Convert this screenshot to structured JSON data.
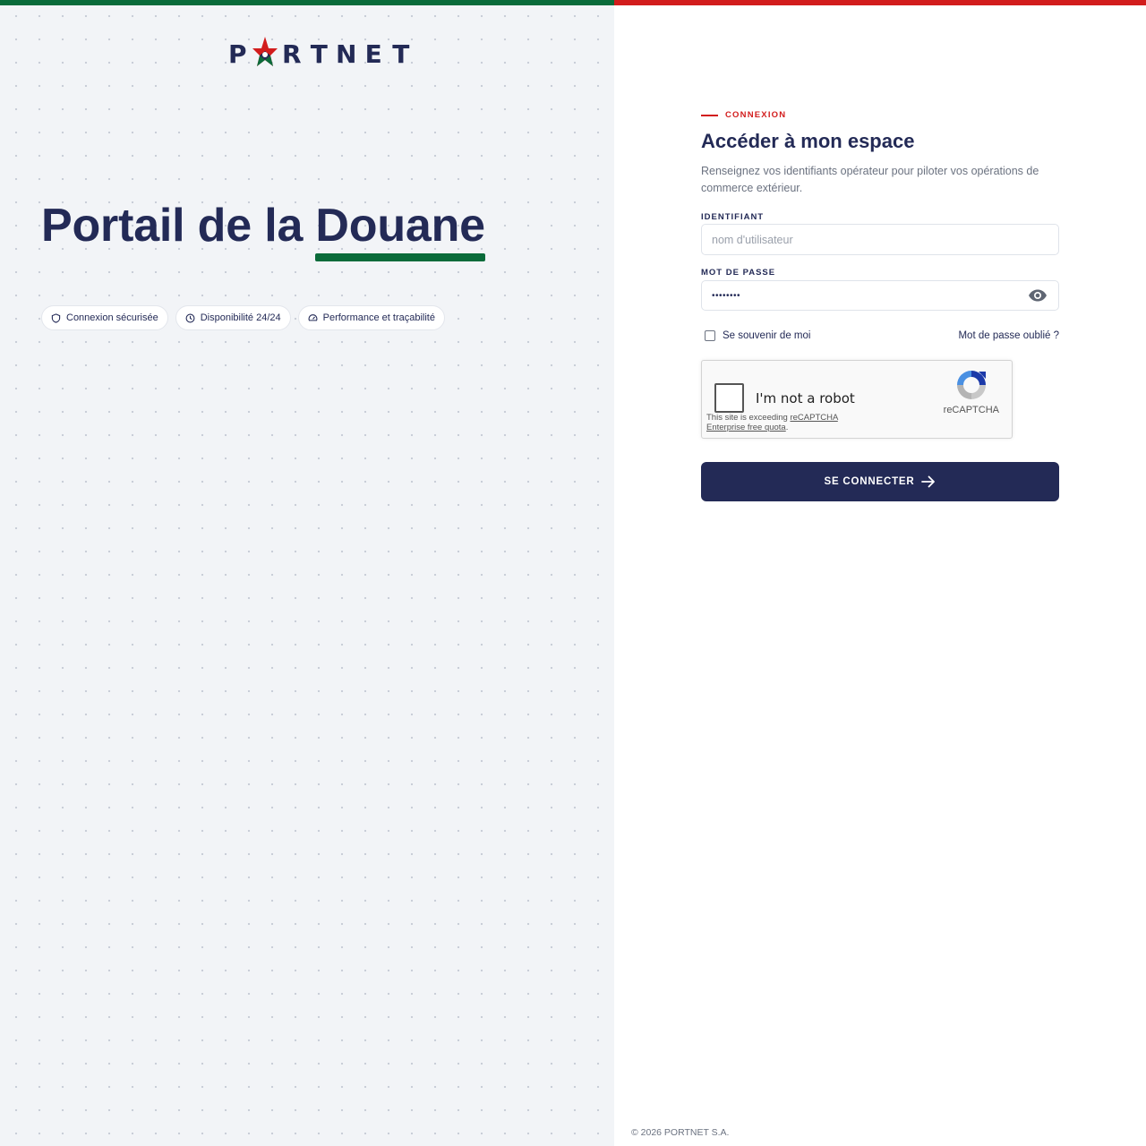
{
  "brand": {
    "logo_letters": [
      "P",
      "R",
      "T",
      "N",
      "E",
      "T"
    ],
    "colors": {
      "navy": "#232a56",
      "green": "#0a6b3a",
      "red": "#d21c1c"
    }
  },
  "hero": {
    "title_part1": "Portail de la ",
    "title_highlight": "Douane"
  },
  "chips": [
    {
      "icon": "shield-icon",
      "label": "Connexion sécurisée"
    },
    {
      "icon": "clock-icon",
      "label": "Disponibilité 24/24"
    },
    {
      "icon": "gauge-icon",
      "label": "Performance et traçabilité"
    }
  ],
  "form": {
    "eyebrow": "CONNEXION",
    "title": "Accéder à mon espace",
    "description": "Renseignez vos identifiants opérateur pour piloter vos opérations de commerce extérieur.",
    "username_label": "IDENTIFIANT",
    "username_placeholder": "nom d'utilisateur",
    "username_value": "",
    "password_label": "MOT DE PASSE",
    "password_value": "••••••••",
    "remember_label": "Se souvenir de moi",
    "forgot_label": "Mot de passe oublié ?",
    "submit_label": "SE CONNECTER"
  },
  "captcha": {
    "label": "I'm not a robot",
    "brand": "reCAPTCHA",
    "warning_prefix": "This site is exceeding ",
    "warning_link1": "reCAPTCHA",
    "warning_link2": "Enterprise free quota",
    "warning_suffix": "."
  },
  "footer": {
    "copyright": "© 2026 PORTNET S.A."
  }
}
